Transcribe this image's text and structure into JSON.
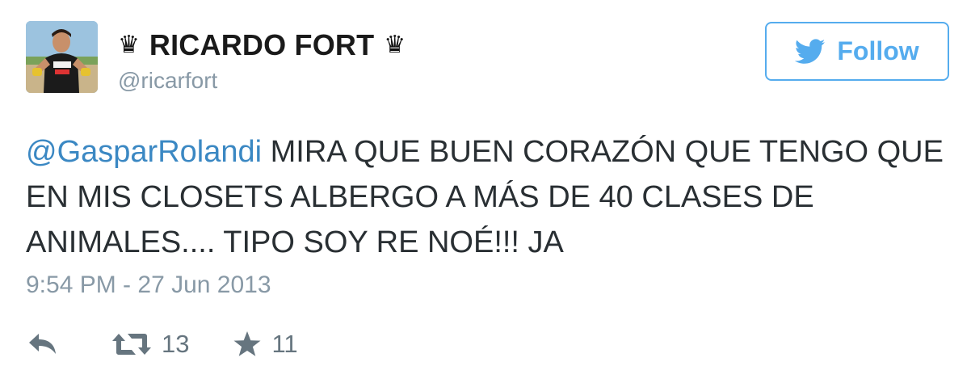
{
  "user": {
    "crown_left": "♛",
    "display_name": "RICARDO FORT",
    "crown_right": "♛",
    "handle": "@ricarfort",
    "avatar_icon": "profile-photo"
  },
  "follow_button": {
    "label": "Follow",
    "icon": "twitter-bird-icon",
    "accent_color": "#55acee"
  },
  "tweet": {
    "mention": "@GasparRolandi",
    "text": " MIRA QUE BUEN CORAZÓN QUE TENGO QUE EN MIS CLOSETS ALBERGO A MÁS DE 40 CLASES DE ANIMALES.... TIPO SOY RE NOÉ!!! JA",
    "timestamp": "9:54 PM - 27 Jun 2013"
  },
  "actions": {
    "reply_icon": "reply-icon",
    "retweet_icon": "retweet-icon",
    "retweet_count": "13",
    "favorite_icon": "star-icon",
    "favorite_count": "11"
  },
  "colors": {
    "link": "#3b88c3",
    "muted": "#8899a6",
    "action_icon": "#66757f"
  }
}
